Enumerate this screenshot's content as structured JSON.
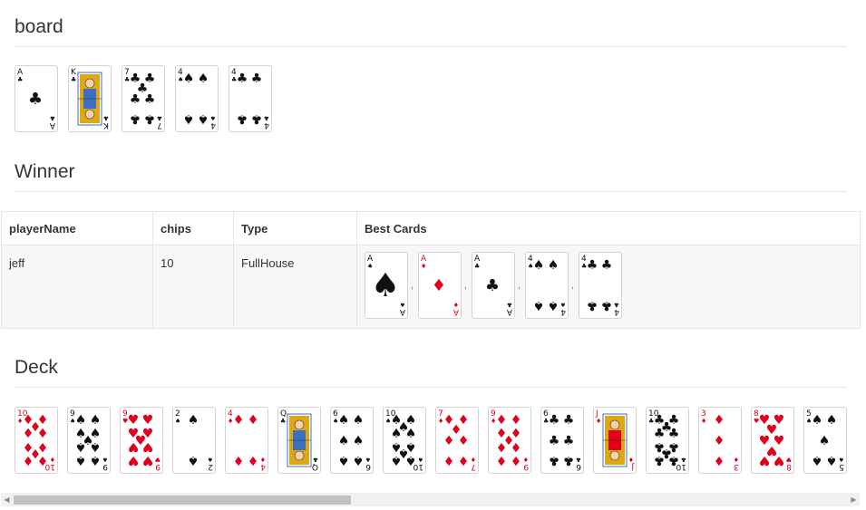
{
  "board": {
    "title": "board",
    "cards": [
      {
        "rank": "A",
        "suit": "clubs"
      },
      {
        "rank": "K",
        "suit": "clubs",
        "face": true
      },
      {
        "rank": "7",
        "suit": "clubs"
      },
      {
        "rank": "4",
        "suit": "spades"
      },
      {
        "rank": "4",
        "suit": "clubs"
      }
    ]
  },
  "winner": {
    "title": "Winner",
    "columns": [
      "playerName",
      "chips",
      "Type",
      "Best Cards"
    ],
    "rows": [
      {
        "playerName": "jeff",
        "chips": "10",
        "type": "FullHouse",
        "best_cards": [
          {
            "rank": "A",
            "suit": "spades",
            "big": true
          },
          {
            "rank": "A",
            "suit": "diamonds"
          },
          {
            "rank": "A",
            "suit": "clubs"
          },
          {
            "rank": "4",
            "suit": "spades"
          },
          {
            "rank": "4",
            "suit": "clubs"
          }
        ],
        "separator": ","
      }
    ]
  },
  "deck": {
    "title": "Deck",
    "cards": [
      {
        "rank": "10",
        "suit": "diamonds"
      },
      {
        "rank": "9",
        "suit": "spades"
      },
      {
        "rank": "9",
        "suit": "hearts"
      },
      {
        "rank": "2",
        "suit": "spades"
      },
      {
        "rank": "4",
        "suit": "diamonds"
      },
      {
        "rank": "Q",
        "suit": "clubs",
        "face": true
      },
      {
        "rank": "6",
        "suit": "spades"
      },
      {
        "rank": "10",
        "suit": "spades"
      },
      {
        "rank": "7",
        "suit": "diamonds"
      },
      {
        "rank": "9",
        "suit": "diamonds"
      },
      {
        "rank": "6",
        "suit": "clubs"
      },
      {
        "rank": "J",
        "suit": "diamonds",
        "face": true
      },
      {
        "rank": "10",
        "suit": "clubs"
      },
      {
        "rank": "3",
        "suit": "diamonds"
      },
      {
        "rank": "8",
        "suit": "hearts"
      },
      {
        "rank": "5",
        "suit": "spades"
      }
    ]
  },
  "scrollbar": {
    "left_arrow": "◀",
    "right_arrow": "▶",
    "position_fraction": 0.0,
    "visible_fraction": 0.39
  },
  "colors": {
    "red": "#e0001b",
    "black": "#111111",
    "face_blue": "#3a6fc4",
    "face_gold": "#e0a810"
  }
}
